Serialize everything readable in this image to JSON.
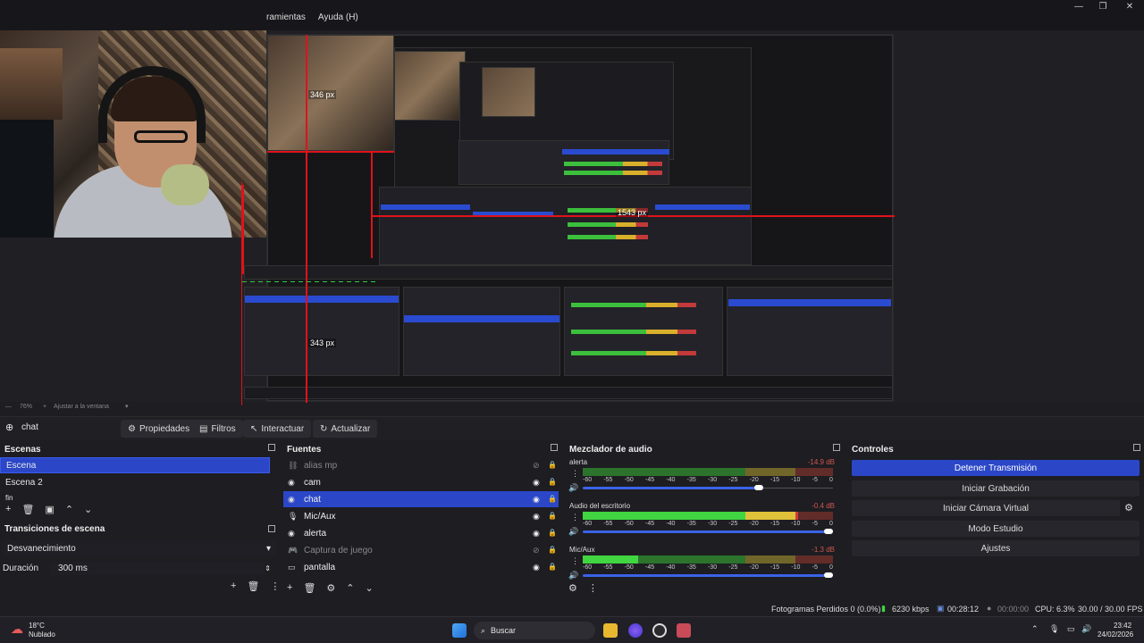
{
  "menu": [
    "ramientas",
    "Ayuda (H)"
  ],
  "window_controls": [
    "—",
    "❐",
    "✕"
  ],
  "preview": {
    "measure_labels": [
      "346 px",
      "1543 px",
      "343 px"
    ],
    "nested_window_menu": "amientas  Ayuda (H)"
  },
  "zoom": {
    "level": "76%",
    "fit_label": "Ajustar a la ventana"
  },
  "source_toolbar": {
    "selected_source": "chat",
    "buttons": [
      "Propiedades",
      "Filtros",
      "Interactuar",
      "Actualizar"
    ]
  },
  "scenes": {
    "title": "Escenas",
    "items": [
      {
        "label": "Escena",
        "selected": true
      },
      {
        "label": "Escena 2",
        "selected": false
      },
      {
        "label": "fin",
        "selected": false
      }
    ]
  },
  "transitions": {
    "title": "Transiciones de escena",
    "type": "Desvanecimiento",
    "duration_label": "Duración",
    "duration_value": "300 ms"
  },
  "sources": {
    "title": "Fuentes",
    "items": [
      {
        "label": "alias mp",
        "icon": "link-icon",
        "hidden": true,
        "selected": false
      },
      {
        "label": "cam",
        "icon": "globe-icon",
        "hidden": false,
        "selected": false
      },
      {
        "label": "chat",
        "icon": "globe-icon",
        "hidden": false,
        "selected": true
      },
      {
        "label": "Mic/Aux",
        "icon": "mic-icon",
        "hidden": false,
        "selected": false
      },
      {
        "label": "alerta",
        "icon": "globe-icon",
        "hidden": false,
        "selected": false
      },
      {
        "label": "Captura de juego",
        "icon": "gamepad-icon",
        "hidden": true,
        "selected": false
      },
      {
        "label": "pantalla",
        "icon": "monitor-icon",
        "hidden": false,
        "selected": false
      }
    ]
  },
  "mixer": {
    "title": "Mezclador de audio",
    "scale": [
      "-60",
      "-55",
      "-50",
      "-45",
      "-40",
      "-35",
      "-30",
      "-25",
      "-20",
      "-15",
      "-10",
      "-5",
      "0"
    ],
    "channels": [
      {
        "name": "alerta",
        "db": "-14.9 dB",
        "level": 0.0,
        "volume": 0.72
      },
      {
        "name": "Audio del escritorio",
        "db": "-0.4 dB",
        "level": 0.86,
        "volume": 1.0
      },
      {
        "name": "Mic/Aux",
        "db": "-1.3 dB",
        "level": 0.22,
        "volume": 1.0
      }
    ]
  },
  "controls": {
    "title": "Controles",
    "buttons": [
      "Detener Transmisión",
      "Iniciar Grabación",
      "Iniciar Cámara Virtual",
      "Modo Estudio",
      "Ajustes"
    ]
  },
  "status": {
    "dropped": "Fotogramas Perdidos 0 (0.0%)",
    "bitrate": "6230 kbps",
    "stream_time": "00:28:12",
    "rec_time": "00:00:00",
    "cpu": "CPU: 6.3%",
    "fps": "30.00 / 30.00 FPS"
  },
  "taskbar": {
    "weather_temp": "18°C",
    "weather_desc": "Nublado",
    "search": "Buscar",
    "time": "23:42",
    "date": "24/02/2026"
  },
  "colors": {
    "accent": "#2b47c8",
    "panel": "#1d1d22",
    "meter_green": "#41d541",
    "meter_yellow": "#e0c13a",
    "meter_red": "#d03c3c",
    "guide_red": "#e0121b"
  }
}
